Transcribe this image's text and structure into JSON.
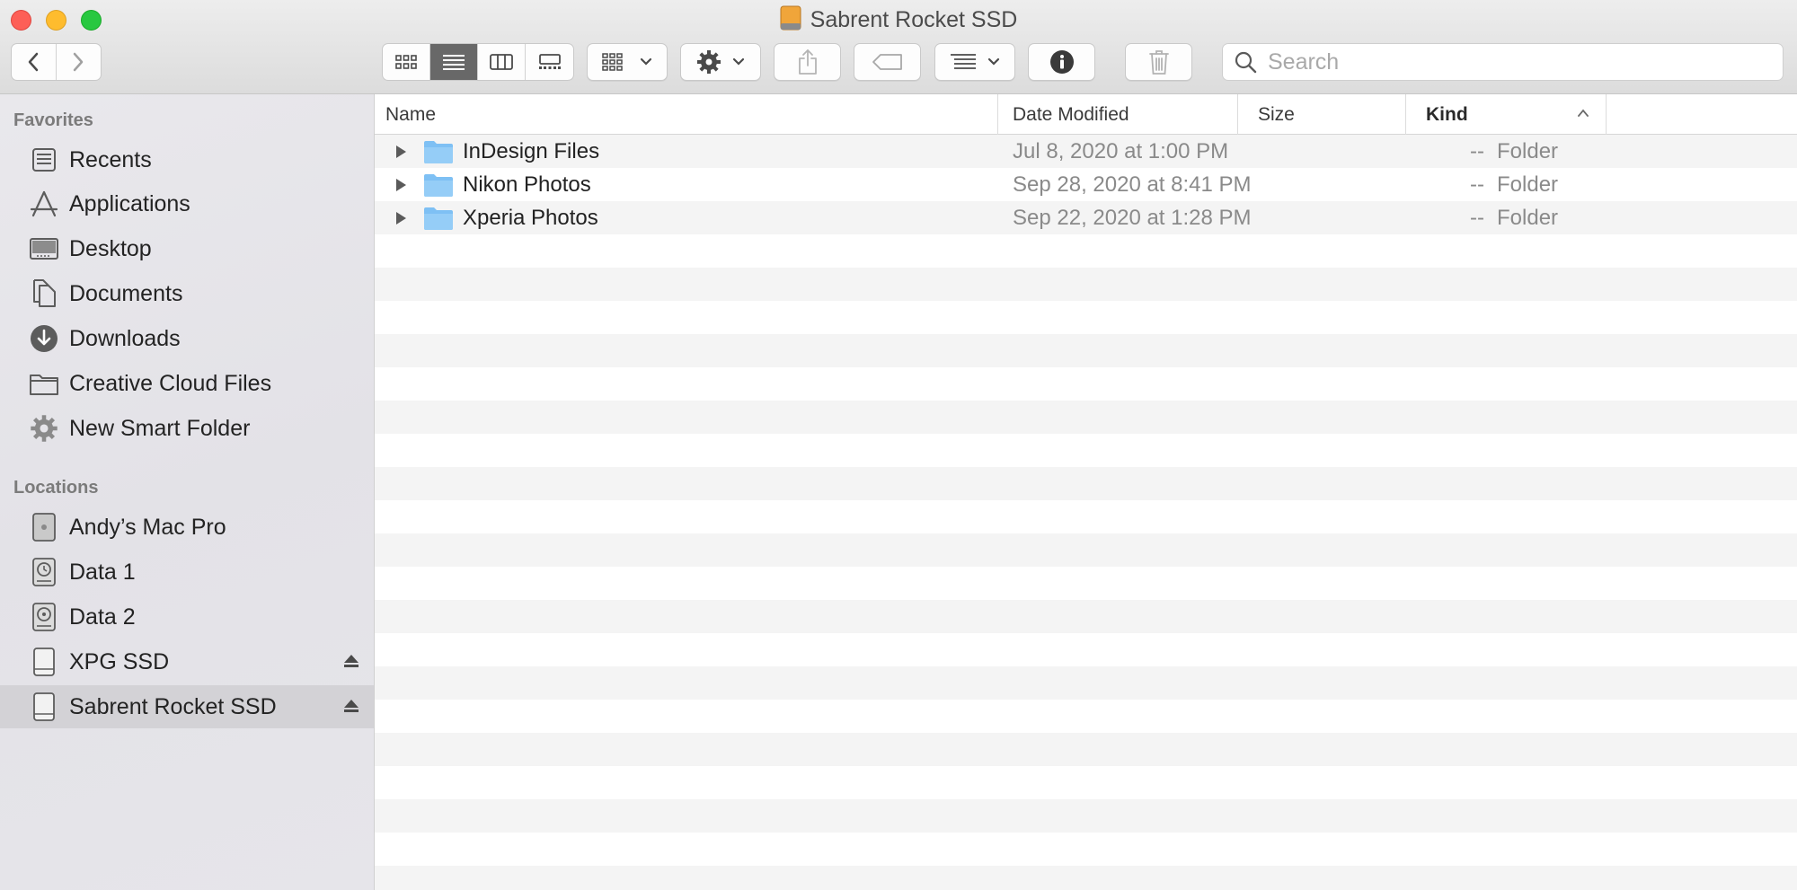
{
  "window": {
    "title": "Sabrent Rocket SSD"
  },
  "search": {
    "placeholder": "Search"
  },
  "sidebar": {
    "favorites_heading": "Favorites",
    "favorites": [
      {
        "label": "Recents",
        "icon": "recents-icon"
      },
      {
        "label": "Applications",
        "icon": "applications-icon"
      },
      {
        "label": "Desktop",
        "icon": "desktop-icon"
      },
      {
        "label": "Documents",
        "icon": "documents-icon"
      },
      {
        "label": "Downloads",
        "icon": "downloads-icon"
      },
      {
        "label": "Creative Cloud Files",
        "icon": "folder-icon"
      },
      {
        "label": "New Smart Folder",
        "icon": "gear-icon"
      }
    ],
    "locations_heading": "Locations",
    "locations": [
      {
        "label": "Andy’s Mac Pro",
        "icon": "computer-icon"
      },
      {
        "label": "Data 1",
        "icon": "time-machine-disk-icon"
      },
      {
        "label": "Data 2",
        "icon": "hard-disk-icon"
      },
      {
        "label": "XPG SSD",
        "icon": "external-drive-icon",
        "ejectable": true
      },
      {
        "label": "Sabrent Rocket SSD",
        "icon": "external-drive-icon",
        "ejectable": true,
        "selected": true
      }
    ]
  },
  "columns": {
    "name": "Name",
    "date": "Date Modified",
    "size": "Size",
    "kind": "Kind"
  },
  "files": [
    {
      "name": "InDesign Files",
      "date": "Jul 8, 2020 at 1:00 PM",
      "size": "--",
      "kind": "Folder"
    },
    {
      "name": "Nikon Photos",
      "date": "Sep 28, 2020 at 8:41 PM",
      "size": "--",
      "kind": "Folder"
    },
    {
      "name": "Xperia Photos",
      "date": "Sep 22, 2020 at 1:28 PM",
      "size": "--",
      "kind": "Folder"
    }
  ],
  "colors": {
    "folder": "#7ec0f4",
    "selected_sidebar": "#d3d2d6",
    "active_view": "#686868"
  }
}
